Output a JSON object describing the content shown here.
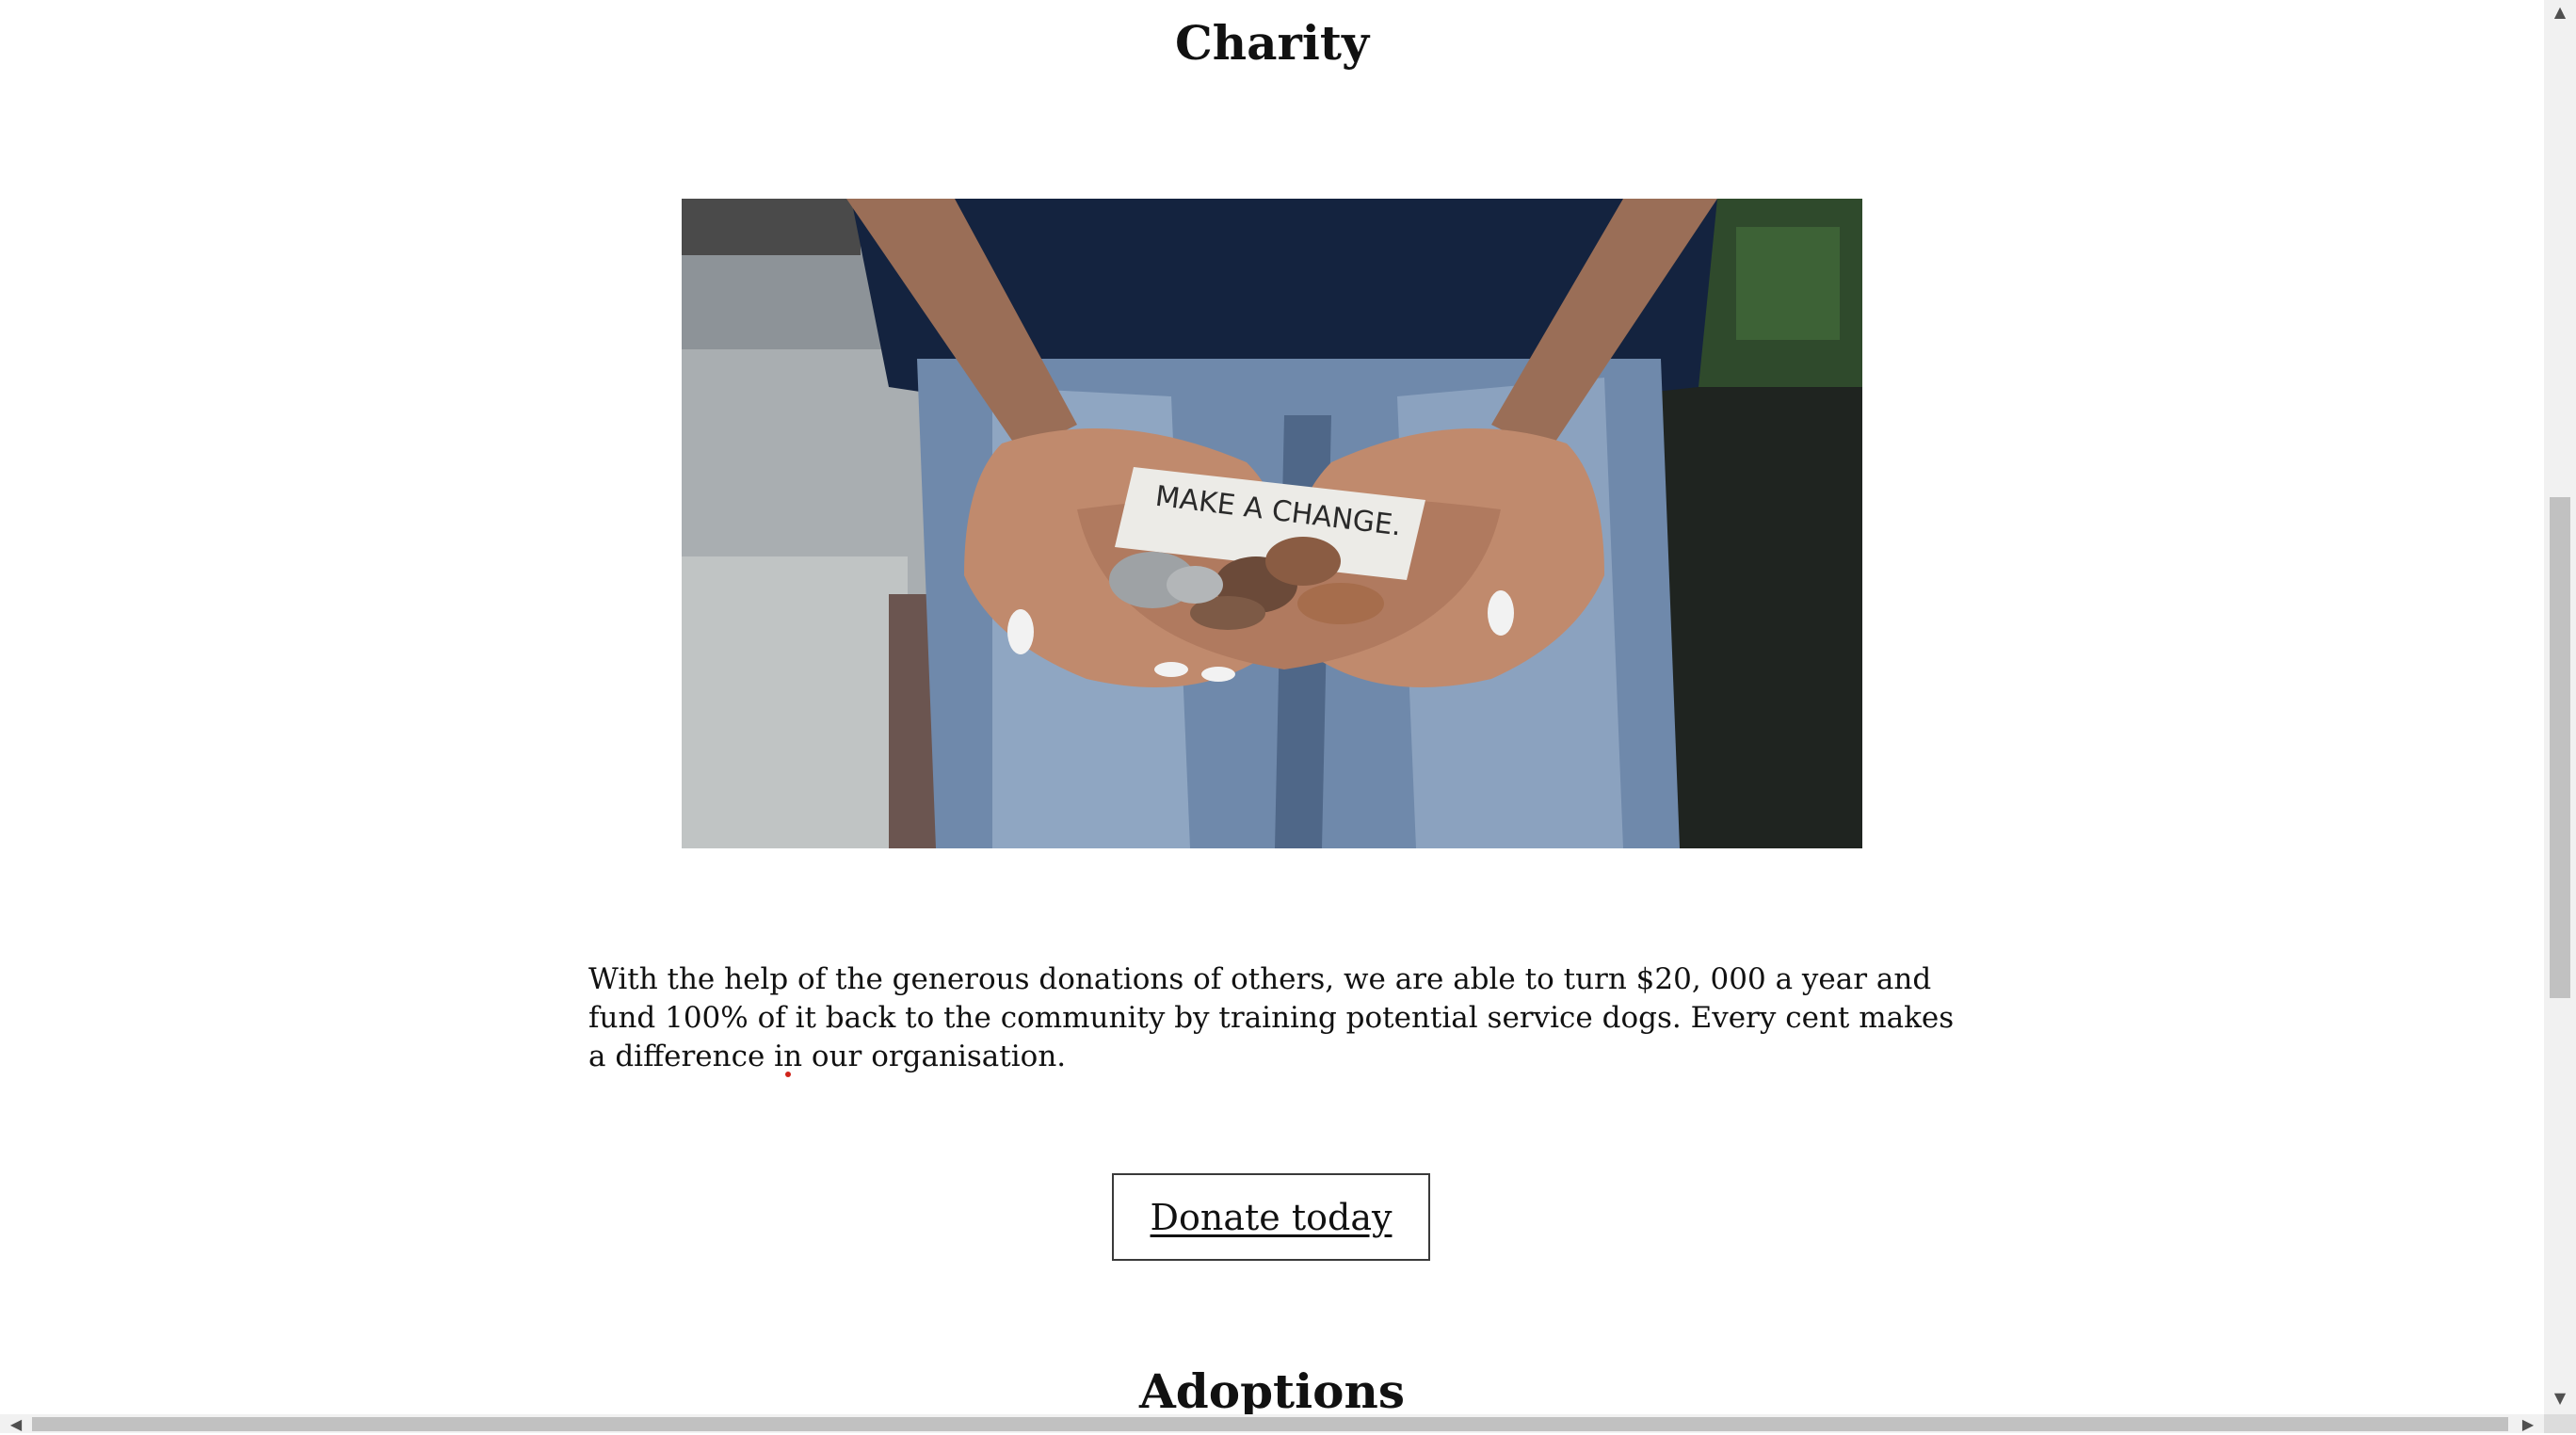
{
  "charity": {
    "heading": "Charity",
    "image_note_text": "MAKE A CHANGE.",
    "paragraph_part1": "With the help of the generous donations of others, we are able to turn $20, 000 a year and fund 100% of it back to the community by training potential service dogs. Every cent makes a difference ",
    "paragraph_flagged_word": "in",
    "paragraph_part2": " our organisation.",
    "donate_label": "Donate today"
  },
  "adoptions": {
    "heading": "Adoptions"
  },
  "scrollbars": {
    "up_arrow": "▲",
    "down_arrow": "▼",
    "left_arrow": "◀",
    "right_arrow": "▶"
  },
  "colors": {
    "background": "#ffffff",
    "text": "#111111",
    "button_border": "#3a3a3a",
    "spellcheck_dot": "#d0241b"
  }
}
